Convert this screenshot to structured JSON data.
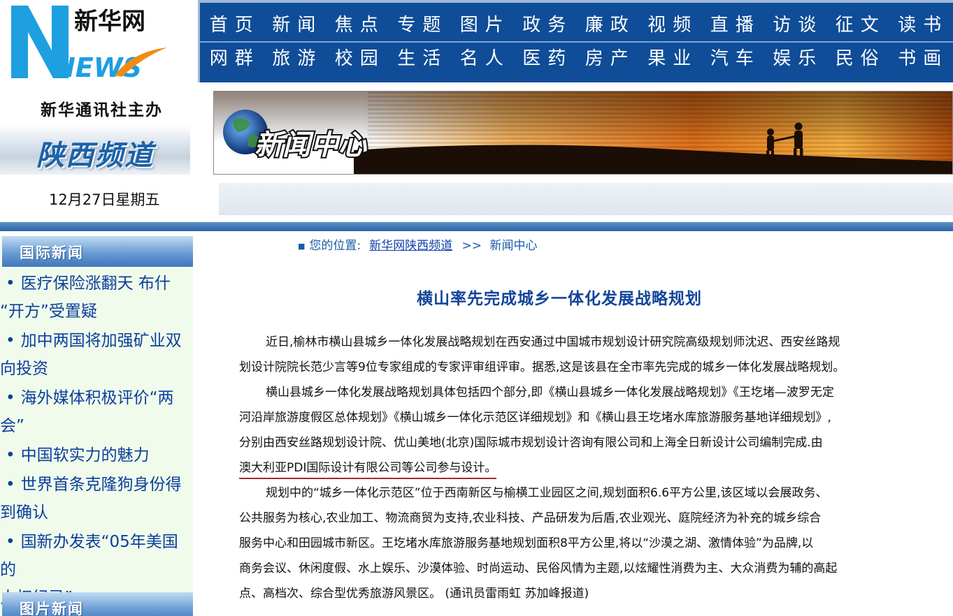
{
  "header": {
    "logo_text_cn": "新华网",
    "logo_text_en": "NEWS",
    "org_name": "新华通讯社主办",
    "channel_name": "陕西频道",
    "date": "12月27日星期五"
  },
  "nav": {
    "row1": [
      "首页",
      "新闻",
      "焦点",
      "专题",
      "图片",
      "政务",
      "廉政",
      "视频",
      "直播",
      "访谈",
      "征文",
      "读书"
    ],
    "row2": [
      "网群",
      "旅游",
      "校园",
      "生活",
      "名人",
      "医药",
      "房产",
      "果业",
      "汽车",
      "娱乐",
      "民俗",
      "书画"
    ]
  },
  "banner": {
    "title": "新闻中心"
  },
  "sidebar": {
    "intl_heading": "国际新闻",
    "items": [
      {
        "line1": "医疗保险涨翻天 布什",
        "line2": "“开方”受置疑"
      },
      {
        "line1": "加中两国将加强矿业双",
        "line2": "向投资"
      },
      {
        "line1": "海外媒体积极评价“两",
        "line2": "会”"
      },
      {
        "line1": "中国软实力的魅力",
        "line2": ""
      },
      {
        "line1": "世界首条克隆狗身份得",
        "line2": "到确认"
      },
      {
        "line1": "国新办发表“05年美国的",
        "line2": "人权纪录”"
      }
    ],
    "photo_heading": "图片新闻"
  },
  "breadcrumb": {
    "prefix": "您的位置:",
    "link": "新华网陕西频道",
    "separator": ">>",
    "current": "新闻中心"
  },
  "article": {
    "title": "横山率先完成城乡一体化发展战略规划",
    "lines": [
      "近日,榆林市横山县城乡一体化发展战略规划在西安通过中国城市规划设计研究院高级规划师沈迟、西安丝路规",
      "划设计院院长范少言等9位专家组成的专家评审组评审。据悉,这是该县在全市率先完成的城乡一体化发展战略规划。",
      "横山县城乡一体化发展战略规划具体包括四个部分,即《横山县城乡一体化发展战略规划》《王圪堵—波罗无定",
      "河沿岸旅游度假区总体规划》《横山城乡一体化示范区详细规划》和《横山县王圪堵水库旅游服务基地详细规划》,",
      "分别由西安丝路规划设计院、优山美地(北京)国际城市规划设计咨询有限公司和上海全日新设计公司编制完成.由",
      "澳大利亚PDI国际设计有限公司等公司参与设计。",
      "规划中的“城乡一体化示范区”位于西南新区与榆横工业园区之间,规划面积6.6平方公里,该区域以会展政务、",
      "公共服务为核心,农业加工、物流商贸为支持,农业科技、产品研发为后盾,农业观光、庭院经济为补充的城乡综合",
      "服务中心和田园城市新区。王圪堵水库旅游服务基地规划面积8平方公里,将以“沙漠之湖、激情体验”为品牌,以",
      "商务会议、休闲度假、水上娱乐、沙漠体验、时尚运动、民俗风情为主题,以炫耀性消费为主、大众消费为辅的高起",
      "点、高档次、综合型优秀旅游风景区。 (通讯员雷雨虹 苏加峰报道)"
    ]
  },
  "colors": {
    "nav_bg": "#0f4d98",
    "title_blue": "#13449a",
    "link_blue": "#0a3f9c",
    "sidebar_bg": "#f0fbec",
    "underline_red": "#a52a2a"
  }
}
